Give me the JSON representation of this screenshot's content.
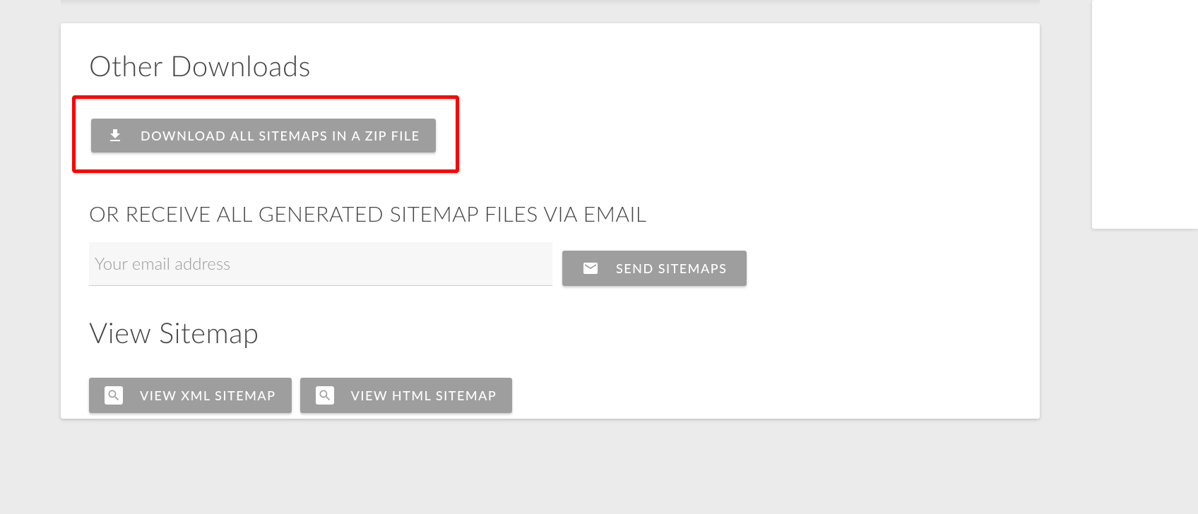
{
  "headings": {
    "other_downloads": "Other Downloads",
    "email_subtitle": "OR RECEIVE ALL GENERATED SITEMAP FILES VIA EMAIL",
    "view_sitemap": "View Sitemap"
  },
  "buttons": {
    "download_zip": "DOWNLOAD ALL SITEMAPS IN A ZIP FILE",
    "send_sitemaps": "SEND SITEMAPS",
    "view_xml": "VIEW XML SITEMAP",
    "view_html": "VIEW HTML SITEMAP"
  },
  "inputs": {
    "email_placeholder": "Your email address",
    "email_value": ""
  }
}
